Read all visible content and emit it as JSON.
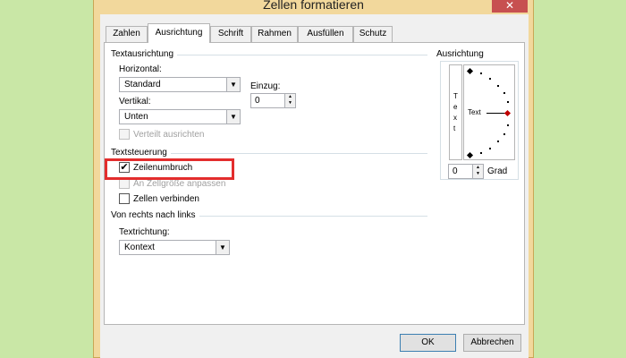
{
  "window": {
    "title": "Zellen formatieren",
    "close_glyph": "✕"
  },
  "tabs": [
    "Zahlen",
    "Ausrichtung",
    "Schrift",
    "Rahmen",
    "Ausfüllen",
    "Schutz"
  ],
  "active_tab": "Ausrichtung",
  "textausrichtung": {
    "group_label": "Textausrichtung",
    "horizontal_label": "Horizontal:",
    "horizontal_value": "Standard",
    "vertikal_label": "Vertikal:",
    "vertikal_value": "Unten",
    "einzug_label": "Einzug:",
    "einzug_value": "0",
    "verteilt_label": "Verteilt ausrichten"
  },
  "textsteuerung": {
    "group_label": "Textsteuerung",
    "zeilenumbruch_label": "Zeilenumbruch",
    "zeilenumbruch_checked": true,
    "zellgroesse_label": "An Zellgröße anpassen",
    "zellen_verbinden_label": "Zellen verbinden"
  },
  "rechts_nach_links": {
    "group_label": "Von rechts nach links",
    "textrichtung_label": "Textrichtung:",
    "textrichtung_value": "Kontext"
  },
  "ausrichtung_panel": {
    "group_label": "Ausrichtung",
    "vertical_text_letters": [
      "T",
      "e",
      "x",
      "t"
    ],
    "dial_text": "Text",
    "grad_value": "0",
    "grad_label": "Grad"
  },
  "buttons": {
    "ok": "OK",
    "cancel": "Abbrechen"
  },
  "colors": {
    "highlight": "#e32d2d",
    "frame": "#f2d89c",
    "background": "#c9e7a6"
  }
}
